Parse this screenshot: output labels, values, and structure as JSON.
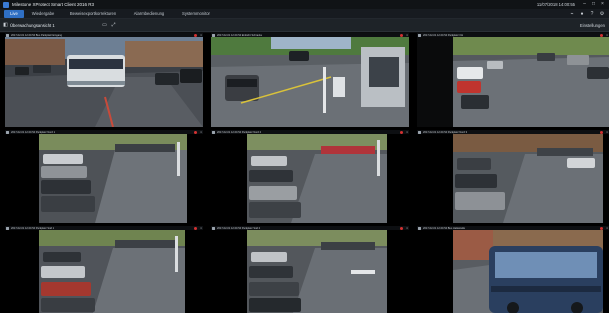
{
  "window": {
    "title": "Milestone XProtect Smart Client 2016 R3",
    "clock": "11/07/2018 14:00:55"
  },
  "tabs": [
    {
      "label": "Live",
      "active": true
    },
    {
      "label": "Wiedergabe",
      "active": false
    },
    {
      "label": "Beweisexportkorrekturen",
      "active": false
    },
    {
      "label": "Alarmbedienung",
      "active": false
    },
    {
      "label": "Systemmonitor",
      "active": false
    }
  ],
  "viewbar": {
    "view_name": "Überwachungsansicht 1",
    "settings_label": "Einstellungen"
  },
  "icons": {
    "app": "app-logo-icon",
    "minimize": "minimize-icon",
    "maximize": "maximize-icon",
    "close": "close-icon",
    "collapse": "collapse-panel-icon",
    "record": "record-indicator-icon"
  },
  "cameras": [
    {
      "name": "2017-02-01 12.00.54 Bus Parkplatz Eingang"
    },
    {
      "name": "2017-02-01 12.00.54 Einfahrt Schranke"
    },
    {
      "name": "2017-02-01 12.00.54 Parkplatz Ost"
    },
    {
      "name": "2017-02-01 12.00.54 Parkplatz Nord 1"
    },
    {
      "name": "2017-02-01 12.00.54 Parkplatz Nord 2"
    },
    {
      "name": "2017-02-01 12.00.54 Parkplatz Nord 3"
    },
    {
      "name": "2017-02-01 12.00.54 Parkplatz Süd 1"
    },
    {
      "name": "2017-02-01 12.00.54 Parkplatz Süd 2"
    },
    {
      "name": "2017-02-01 12.00.54 Bus Haltestelle"
    }
  ],
  "colors": {
    "accent": "#2f6fc4",
    "record": "#d33131",
    "background": "#0b0c0e"
  }
}
